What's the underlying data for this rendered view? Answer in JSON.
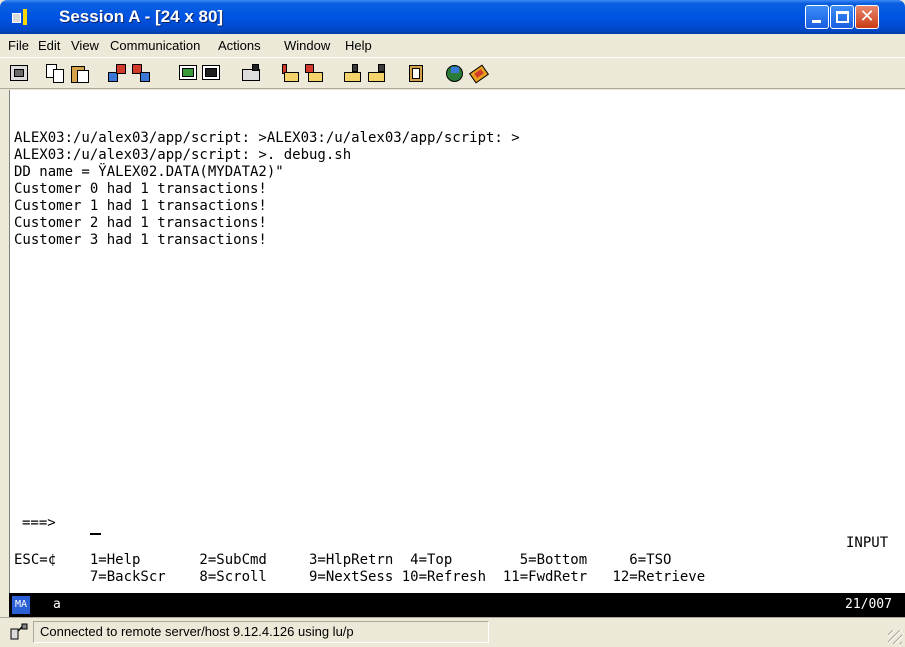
{
  "window": {
    "title": "Session A - [24 x 80]"
  },
  "menubar": {
    "items": [
      "File",
      "Edit",
      "View",
      "Communication",
      "Actions",
      "Window",
      "Help"
    ]
  },
  "toolbar": {
    "icons": [
      "print-screen-icon",
      "copy-icon",
      "paste-icon",
      "send-file-icon",
      "receive-file-icon",
      "display-icon",
      "display-dark-icon",
      "keyboard-map-icon",
      "macro-record-icon",
      "macro-stop-icon",
      "play-macro-icon",
      "play-macro-2-icon",
      "clipboard-icon",
      "globe-icon",
      "help-book-icon"
    ]
  },
  "terminal": {
    "lines": [
      "ALEX03:/u/alex03/app/script: >ALEX03:/u/alex03/app/script: >",
      "ALEX03:/u/alex03/app/script: >. debug.sh",
      "DD name = ŸALEX02.DATA(MYDATA2)\"",
      "Customer 0 had 1 transactions!",
      "Customer 1 had 1 transactions!",
      "Customer 2 had 1 transactions!",
      "Customer 3 had 1 transactions!"
    ],
    "command_prompt": "===>",
    "mode": "INPUT",
    "pf_row1": "ESC=¢    1=Help       2=SubCmd     3=HlpRetrn  4=Top        5=Bottom     6=TSO",
    "pf_row2": "         7=BackScr    8=Scroll     9=NextSess 10=Refresh  11=FwdRetr   12=Retrieve"
  },
  "oia": {
    "indicator": "MA",
    "session_letter": "a",
    "cursor_pos": "21/007"
  },
  "statusbar": {
    "message": "Connected to remote server/host 9.12.4.126 using lu/p"
  },
  "colors": {
    "titlebar": "#0054e3",
    "chrome": "#ece9d8",
    "terminal_bg": "#ffffff",
    "oia_bg": "#000000"
  }
}
